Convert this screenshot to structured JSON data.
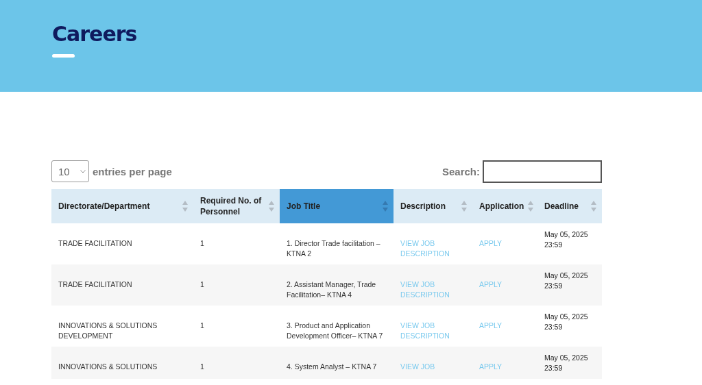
{
  "header": {
    "title": "Careers"
  },
  "controls": {
    "page_size": "10",
    "page_size_label": "entries per page",
    "search_label": "Search:"
  },
  "table": {
    "columns": [
      {
        "label": "Directorate/Department",
        "sorted": false
      },
      {
        "label": "Required No. of Personnel",
        "sorted": false
      },
      {
        "label": "Job Title",
        "sorted": true
      },
      {
        "label": "Description",
        "sorted": false
      },
      {
        "label": "Application",
        "sorted": false
      },
      {
        "label": "Deadline",
        "sorted": false
      }
    ],
    "rows": [
      {
        "department": "TRADE FACILITATION",
        "personnel": "1",
        "job_title": "1. Director Trade facilitation – KTNA 2",
        "description": "VIEW JOB DESCRIPTION",
        "application": "APPLY",
        "deadline": "May 05, 2025 23:59"
      },
      {
        "department": "TRADE FACILITATION",
        "personnel": "1",
        "job_title": "2. Assistant Manager, Trade Facilitation– KTNA 4",
        "description": "VIEW JOB DESCRIPTION",
        "application": "APPLY",
        "deadline": "May 05, 2025 23:59"
      },
      {
        "department": "INNOVATIONS & SOLUTIONS DEVELOPMENT",
        "personnel": "1",
        "job_title": "3. Product and Application Development Officer– KTNA 7",
        "description": "VIEW JOB DESCRIPTION",
        "application": "APPLY",
        "deadline": "May 05, 2025 23:59"
      },
      {
        "department": "INNOVATIONS & SOLUTIONS",
        "personnel": "1",
        "job_title": "4. System Analyst – KTNA 7",
        "description": "VIEW JOB",
        "application": "APPLY",
        "deadline": "May 05, 2025 23:59"
      }
    ]
  }
}
